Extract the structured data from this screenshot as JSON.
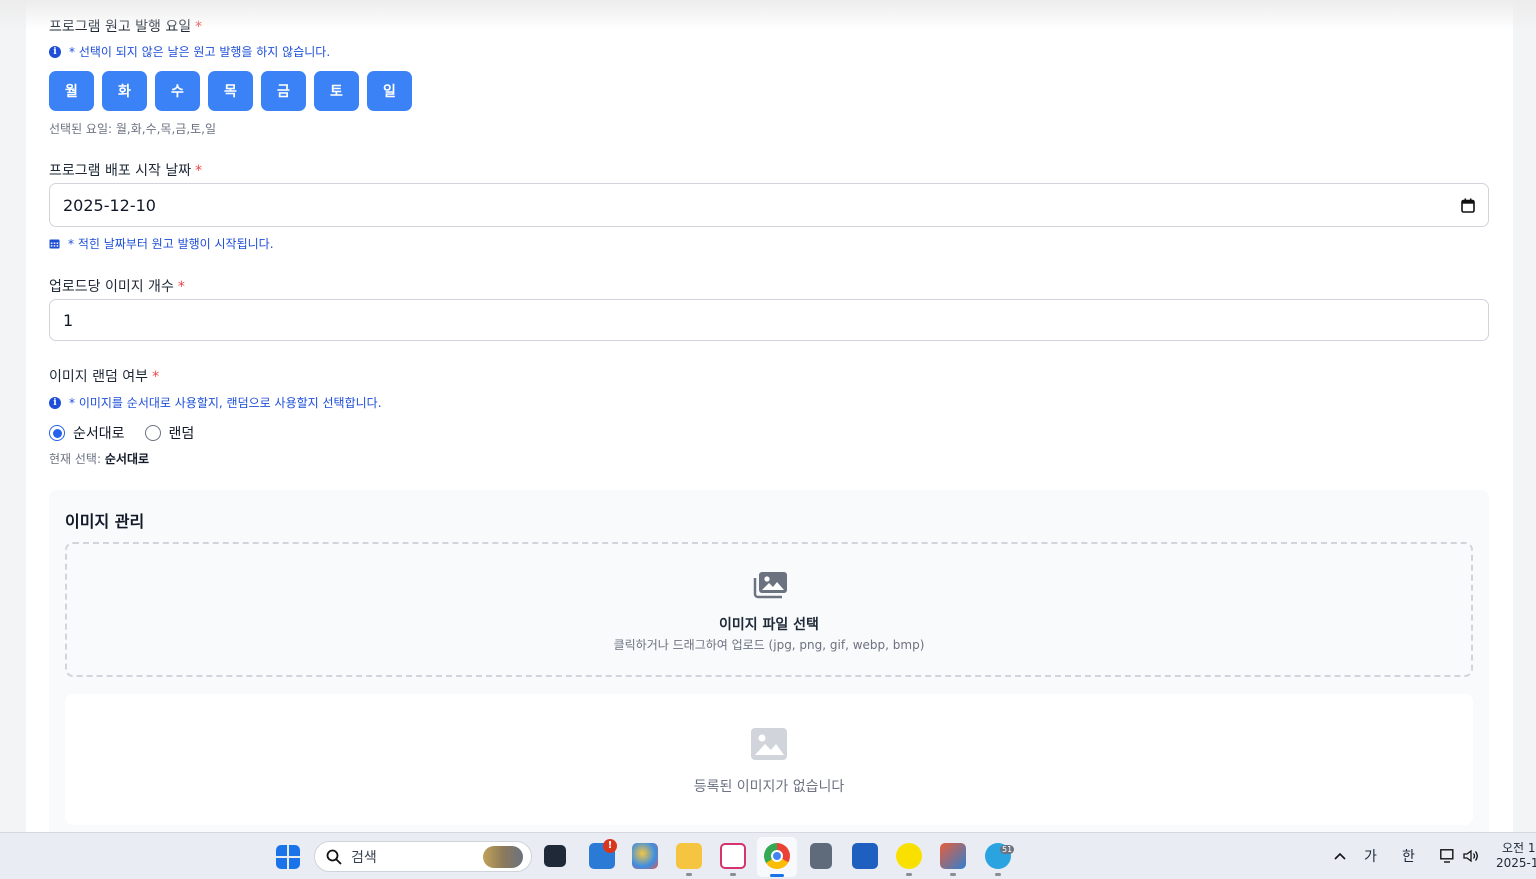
{
  "schedule": {
    "label": "프로그램 원고 발행 요일",
    "required": "*",
    "hint": "* 선택이 되지 않은 날은 원고 발행을 하지 않습니다.",
    "days": [
      "월",
      "화",
      "수",
      "목",
      "금",
      "토",
      "일"
    ],
    "selected_text": "선택된 요일: 월,화,수,목,금,토,일"
  },
  "start_date": {
    "label": "프로그램 배포 시작 날짜",
    "required": "*",
    "value": "2025-12-10",
    "hint": "* 적힌 날짜부터 원고 발행이 시작됩니다."
  },
  "image_count": {
    "label": "업로드당 이미지 개수",
    "required": "*",
    "value": "1"
  },
  "random": {
    "label": "이미지 랜덤 여부",
    "required": "*",
    "hint": "* 이미지를 순서대로 사용할지, 랜덤으로 사용할지 선택합니다.",
    "options": [
      {
        "label": "순서대로",
        "checked": true
      },
      {
        "label": "랜덤",
        "checked": false
      }
    ],
    "current_prefix": "현재 선택:",
    "current_value": "순서대로"
  },
  "image_manage": {
    "title": "이미지 관리",
    "dropzone_title": "이미지 파일 선택",
    "dropzone_sub": "클릭하거나 드래그하여 업로드 (jpg, png, gif, webp, bmp)",
    "empty_text": "등록된 이미지가 없습니다"
  },
  "taskbar": {
    "search_placeholder": "검색",
    "badge_count": "51",
    "ime_1": "가",
    "ime_2": "한",
    "clock_time": "오전 1",
    "clock_date": "2025-1"
  },
  "colors": {
    "primary": "#3b82f6",
    "hint": "#1d4ed8",
    "required": "#ef4444"
  }
}
